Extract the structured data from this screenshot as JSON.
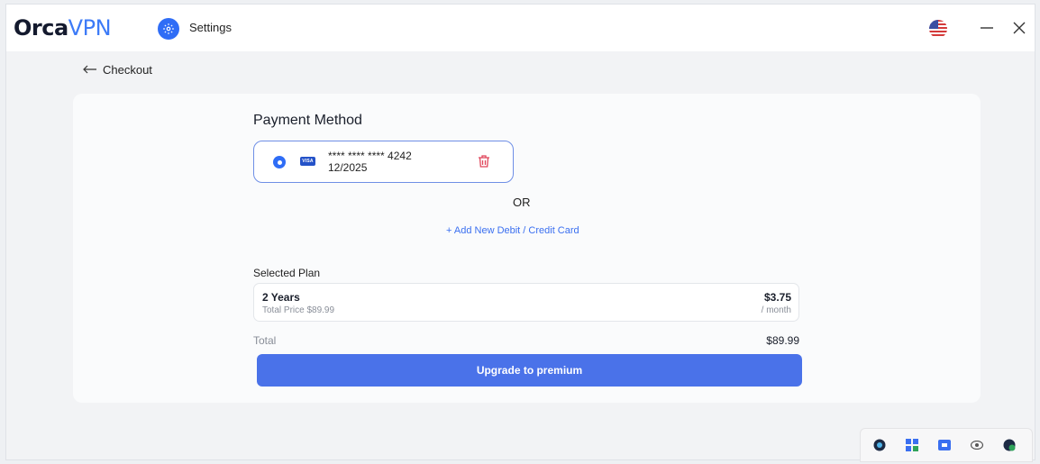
{
  "app": {
    "logo_orca": "Orca",
    "logo_vpn": "VPN",
    "settings_label": "Settings",
    "icons": [
      "gear-icon",
      "us-flag-icon",
      "minimize-icon",
      "close-icon"
    ]
  },
  "nav": {
    "back_label": "Checkout"
  },
  "payment": {
    "title": "Payment Method",
    "card": {
      "brand": "VISA",
      "number": "**** **** **** 4242",
      "expiry": "12/2025",
      "selected": true
    },
    "or_label": "OR",
    "add_card_label": "+ Add New Debit / Credit Card"
  },
  "plan": {
    "section_title": "Selected Plan",
    "name": "2 Years",
    "total_price": "Total Price $89.99",
    "price": "$3.75",
    "per": "/ month"
  },
  "summary": {
    "total_label": "Total",
    "total_value": "$89.99"
  },
  "cta": {
    "label": "Upgrade to premium"
  },
  "tray": {
    "icons": [
      "orca-tray-icon",
      "apps-grid-icon",
      "window-icon",
      "eye-icon",
      "shield-check-icon"
    ]
  },
  "colors": {
    "accent": "#2f6df6",
    "button": "#4a72e9",
    "link": "#3a6ff0",
    "delete": "#e0455a"
  }
}
